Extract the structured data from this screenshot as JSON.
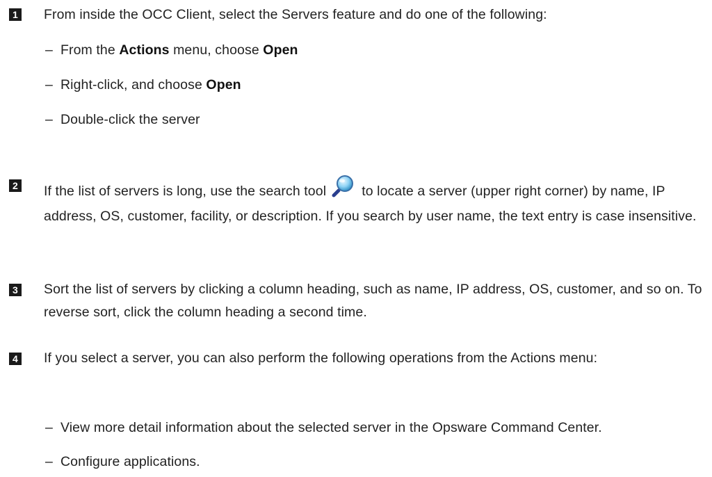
{
  "step1": {
    "number": "1",
    "text": "From inside the OCC Client, select the Servers feature and do one of the following:",
    "options": [
      {
        "pre": "From the ",
        "b1": "Actions",
        "mid": " menu, choose ",
        "b2": "Open"
      },
      {
        "pre": "Right-click, and choose ",
        "b1": "Open"
      },
      {
        "pre": "Double-click the server"
      }
    ]
  },
  "step2": {
    "number": "2",
    "text_before_icon": "If the list of servers is long, use the search tool",
    "icon": "search-icon",
    "text_after_icon": "to locate a server (upper right corner) by name, IP address, OS, customer, facility, or description. If you search by user name, the text entry is case insensitive."
  },
  "step3": {
    "number": "3",
    "text": "Sort the list of servers by clicking a column heading, such as name, IP address, OS, customer, and so on. To reverse sort, click the column heading a second time."
  },
  "step4": {
    "number": "4",
    "text": "If you select a server, you can also perform the following operations from the Actions menu:",
    "items": [
      "View more detail information about the selected server in the Opsware Command Center.",
      "Configure applications."
    ]
  },
  "dash": "–"
}
